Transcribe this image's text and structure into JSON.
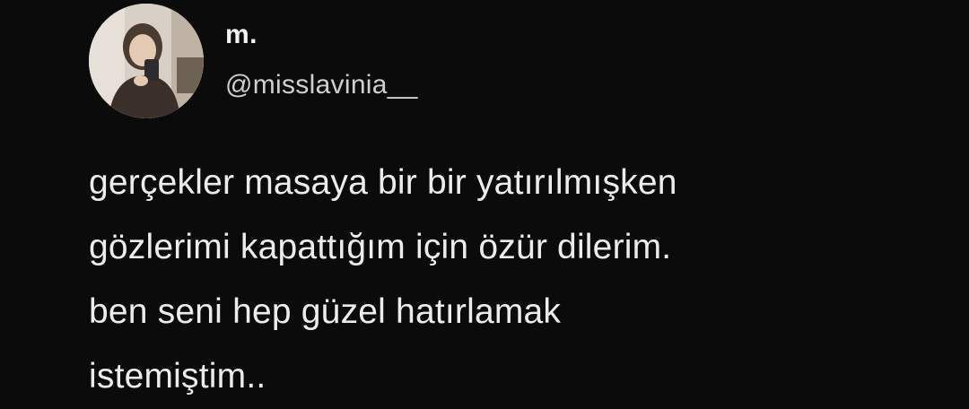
{
  "tweet": {
    "display_name": "m.",
    "handle": "@misslavinia__",
    "avatar_icon": "profile-photo",
    "text_lines": [
      "gerçekler masaya bir bir yatırılmışken",
      "gözlerimi kapattığım için özür dilerim.",
      "ben seni hep güzel hatırlamak",
      "istemiştim.."
    ]
  },
  "colors": {
    "background": "#0b0b0c",
    "text": "#ececed",
    "handle": "#cfcfd1"
  }
}
